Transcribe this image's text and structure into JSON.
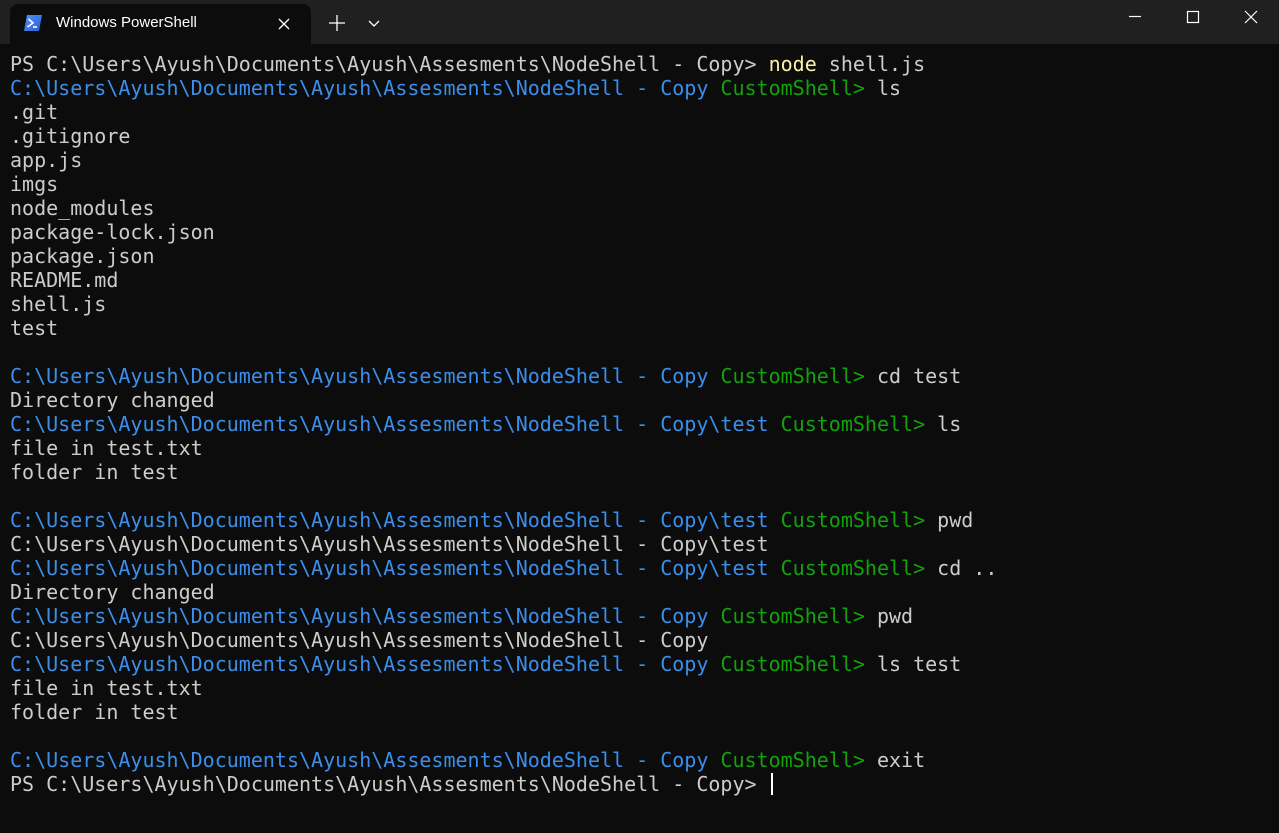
{
  "tab": {
    "title": "Windows PowerShell",
    "icon": "powershell-icon"
  },
  "titlebar_buttons": {
    "new_tab": "plus-icon",
    "dropdown": "chevron-down-icon",
    "minimize": "minimize-icon",
    "maximize": "maximize-icon",
    "close": "close-icon"
  },
  "colors": {
    "background": "#0c0c0c",
    "text": "#cccccc",
    "path": "#3b8eea",
    "shell_prompt": "#13a10e",
    "command_highlight": "#f9f1a5"
  },
  "terminal": {
    "lines": [
      [
        {
          "t": "PS C:\\Users\\Ayush\\Documents\\Ayush\\Assesments\\NodeShell - Copy> ",
          "c": "white"
        },
        {
          "t": "node",
          "c": "yellow"
        },
        {
          "t": " shell.js",
          "c": "white"
        }
      ],
      [
        {
          "t": "C:\\Users\\Ayush\\Documents\\Ayush\\Assesments\\NodeShell - Copy",
          "c": "blue"
        },
        {
          "t": " ",
          "c": "white"
        },
        {
          "t": "CustomShell>",
          "c": "green"
        },
        {
          "t": " ls",
          "c": "white"
        }
      ],
      [
        {
          "t": ".git",
          "c": "white"
        }
      ],
      [
        {
          "t": ".gitignore",
          "c": "white"
        }
      ],
      [
        {
          "t": "app.js",
          "c": "white"
        }
      ],
      [
        {
          "t": "imgs",
          "c": "white"
        }
      ],
      [
        {
          "t": "node_modules",
          "c": "white"
        }
      ],
      [
        {
          "t": "package-lock.json",
          "c": "white"
        }
      ],
      [
        {
          "t": "package.json",
          "c": "white"
        }
      ],
      [
        {
          "t": "README.md",
          "c": "white"
        }
      ],
      [
        {
          "t": "shell.js",
          "c": "white"
        }
      ],
      [
        {
          "t": "test",
          "c": "white"
        }
      ],
      [],
      [
        {
          "t": "C:\\Users\\Ayush\\Documents\\Ayush\\Assesments\\NodeShell - Copy",
          "c": "blue"
        },
        {
          "t": " ",
          "c": "white"
        },
        {
          "t": "CustomShell>",
          "c": "green"
        },
        {
          "t": " cd test",
          "c": "white"
        }
      ],
      [
        {
          "t": "Directory changed",
          "c": "white"
        }
      ],
      [
        {
          "t": "C:\\Users\\Ayush\\Documents\\Ayush\\Assesments\\NodeShell - Copy\\test",
          "c": "blue"
        },
        {
          "t": " ",
          "c": "white"
        },
        {
          "t": "CustomShell>",
          "c": "green"
        },
        {
          "t": " ls",
          "c": "white"
        }
      ],
      [
        {
          "t": "file in test.txt",
          "c": "white"
        }
      ],
      [
        {
          "t": "folder in test",
          "c": "white"
        }
      ],
      [],
      [
        {
          "t": "C:\\Users\\Ayush\\Documents\\Ayush\\Assesments\\NodeShell - Copy\\test",
          "c": "blue"
        },
        {
          "t": " ",
          "c": "white"
        },
        {
          "t": "CustomShell>",
          "c": "green"
        },
        {
          "t": " pwd",
          "c": "white"
        }
      ],
      [
        {
          "t": "C:\\Users\\Ayush\\Documents\\Ayush\\Assesments\\NodeShell - Copy\\test",
          "c": "white"
        }
      ],
      [
        {
          "t": "C:\\Users\\Ayush\\Documents\\Ayush\\Assesments\\NodeShell - Copy\\test",
          "c": "blue"
        },
        {
          "t": " ",
          "c": "white"
        },
        {
          "t": "CustomShell>",
          "c": "green"
        },
        {
          "t": " cd ..",
          "c": "white"
        }
      ],
      [
        {
          "t": "Directory changed",
          "c": "white"
        }
      ],
      [
        {
          "t": "C:\\Users\\Ayush\\Documents\\Ayush\\Assesments\\NodeShell - Copy",
          "c": "blue"
        },
        {
          "t": " ",
          "c": "white"
        },
        {
          "t": "CustomShell>",
          "c": "green"
        },
        {
          "t": " pwd",
          "c": "white"
        }
      ],
      [
        {
          "t": "C:\\Users\\Ayush\\Documents\\Ayush\\Assesments\\NodeShell - Copy",
          "c": "white"
        }
      ],
      [
        {
          "t": "C:\\Users\\Ayush\\Documents\\Ayush\\Assesments\\NodeShell - Copy",
          "c": "blue"
        },
        {
          "t": " ",
          "c": "white"
        },
        {
          "t": "CustomShell>",
          "c": "green"
        },
        {
          "t": " ls test",
          "c": "white"
        }
      ],
      [
        {
          "t": "file in test.txt",
          "c": "white"
        }
      ],
      [
        {
          "t": "folder in test",
          "c": "white"
        }
      ],
      [],
      [
        {
          "t": "C:\\Users\\Ayush\\Documents\\Ayush\\Assesments\\NodeShell - Copy",
          "c": "blue"
        },
        {
          "t": " ",
          "c": "white"
        },
        {
          "t": "CustomShell>",
          "c": "green"
        },
        {
          "t": " exit",
          "c": "white"
        }
      ],
      [
        {
          "t": "PS C:\\Users\\Ayush\\Documents\\Ayush\\Assesments\\NodeShell - Copy> ",
          "c": "white"
        }
      ]
    ]
  }
}
